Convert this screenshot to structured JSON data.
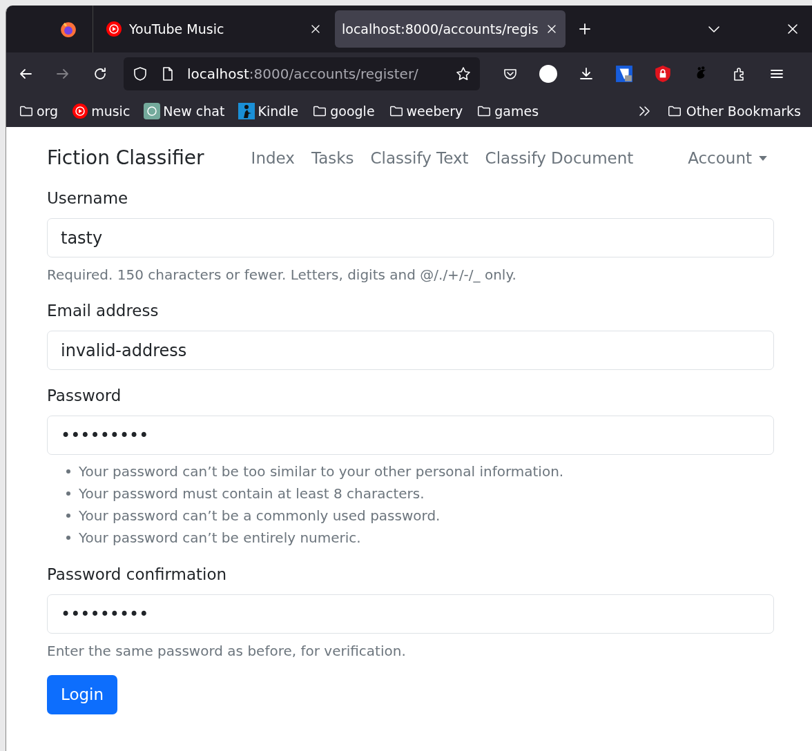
{
  "tabs": [
    {
      "title": "YouTube Music",
      "selected": false
    },
    {
      "title": "localhost:8000/accounts/regis",
      "selected": true
    }
  ],
  "address_bar": {
    "host": "localhost",
    "path": ":8000/accounts/register/"
  },
  "toolbar": {
    "forward_disabled": true
  },
  "bookmarks": [
    {
      "label": "org",
      "kind": "folder"
    },
    {
      "label": "music",
      "kind": "music"
    },
    {
      "label": "New chat",
      "kind": "chat"
    },
    {
      "label": "Kindle",
      "kind": "kindle"
    },
    {
      "label": "google",
      "kind": "folder"
    },
    {
      "label": "weebery",
      "kind": "folder"
    },
    {
      "label": "games",
      "kind": "folder"
    }
  ],
  "other_bookmarks": "Other Bookmarks",
  "navbar": {
    "brand": "Fiction Classifier",
    "links": [
      "Index",
      "Tasks",
      "Classify Text",
      "Classify Document"
    ],
    "account": "Account"
  },
  "form": {
    "fields": [
      {
        "label": "Username",
        "value": "tasty",
        "help": [
          "Required. 150 characters or fewer. Letters, digits and @/./+/-/_ only."
        ],
        "kind": "text"
      },
      {
        "label": "Email address",
        "value": "invalid-address"
      },
      {
        "label": "Password",
        "value": "•••••••••",
        "help": [
          "Your password can’t be too similar to your other personal information.",
          "Your password must contain at least 8 characters.",
          "Your password can’t be a commonly used password.",
          "Your password can’t be entirely numeric."
        ],
        "kind": "list"
      },
      {
        "label": "Password confirmation",
        "value": "•••••••••",
        "help": [
          "Enter the same password as before, for verification."
        ],
        "kind": "text"
      }
    ],
    "submit": "Login"
  }
}
